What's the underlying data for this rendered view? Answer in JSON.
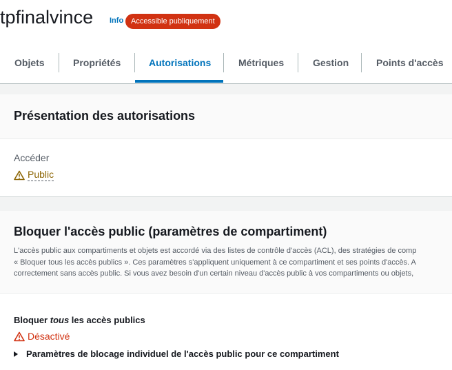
{
  "header": {
    "bucket_name": "tpfinalvince",
    "info_label": "Info",
    "public_badge": "Accessible publiquement"
  },
  "tabs": [
    {
      "label": "Objets"
    },
    {
      "label": "Propriétés"
    },
    {
      "label": "Autorisations",
      "active": true
    },
    {
      "label": "Métriques"
    },
    {
      "label": "Gestion"
    },
    {
      "label": "Points d'accès"
    }
  ],
  "overview": {
    "title": "Présentation des autorisations",
    "access_label": "Accéder",
    "access_value": "Public"
  },
  "block_public": {
    "title": "Bloquer l'accès public (paramètres de compartiment)",
    "description_lines": [
      "L'accès public aux compartiments et objets est accordé via des listes de contrôle d'accès (ACL), des stratégies de comp",
      "« Bloquer tous les accès publics ». Ces paramètres s'appliquent uniquement à ce compartiment et ses points d'accès. A",
      "correctement sans accès public. Si vous avez besoin d'un certain niveau d'accès public à vos compartiments ou objets,"
    ],
    "setting_label_prefix": "Bloquer ",
    "setting_label_emphasis": "tous",
    "setting_label_suffix": " les accès publics",
    "setting_value": "Désactivé",
    "expander_label": "Paramètres de blocage individuel de l'accès public pour ce compartiment"
  },
  "colors": {
    "accent": "#0073bb",
    "badge_red": "#d13212",
    "warning": "#8d6605",
    "error": "#d13212"
  },
  "icons": {
    "public_status": "warning-triangle-icon",
    "disabled_status": "error-triangle-icon",
    "expander": "caret-right-icon"
  }
}
